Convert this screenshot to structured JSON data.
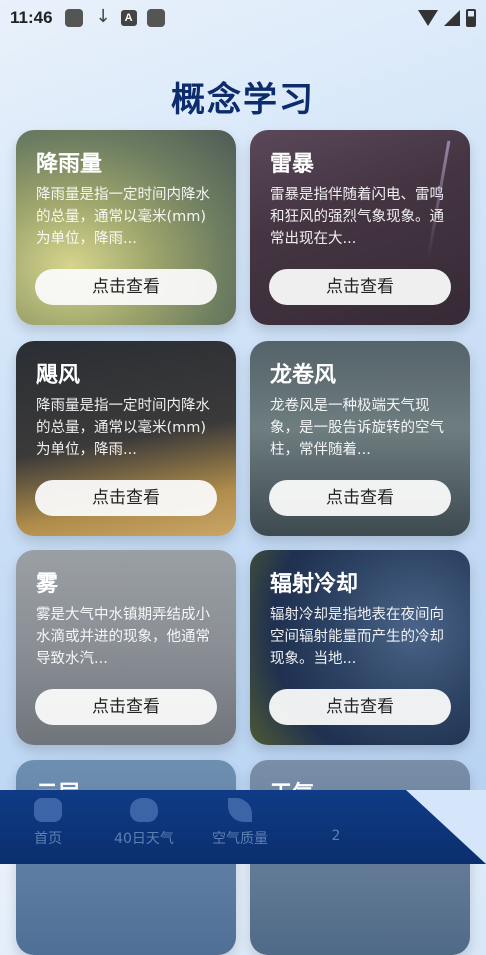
{
  "status": {
    "time": "11:46",
    "a_badge": "A"
  },
  "title": "概念学习",
  "cards": [
    {
      "title": "降雨量",
      "desc": "降雨量是指一定时间内降水的总量，通常以毫米(mm)为单位，降雨...",
      "button": "点击查看"
    },
    {
      "title": "雷暴",
      "desc": "雷暴是指伴随着闪电、雷鸣和狂风的强烈气象现象。通常出现在大...",
      "button": "点击查看"
    },
    {
      "title": "飓风",
      "desc": "降雨量是指一定时间内降水的总量，通常以毫米(mm)为单位，降雨...",
      "button": "点击查看"
    },
    {
      "title": "龙卷风",
      "desc": "龙卷风是一种极端天气现象，是一股告诉旋转的空气柱，常伴随着...",
      "button": "点击查看"
    },
    {
      "title": "雾",
      "desc": "雾是大气中水镇期弄结成小水滴或并进的现象，他通常导致水汽...",
      "button": "点击查看"
    },
    {
      "title": "辐射冷却",
      "desc": "辐射冷却是指地表在夜间向空间辐射能量而产生的冷却现象。当地...",
      "button": "点击查看"
    },
    {
      "title": "云层"
    },
    {
      "title": "天气"
    }
  ],
  "nav": [
    {
      "label": "首页",
      "icon": "home-icon"
    },
    {
      "label": "40日天气",
      "icon": "cloud-icon"
    },
    {
      "label": "空气质量",
      "icon": "leaf-icon"
    },
    {
      "label": "2",
      "icon": ""
    }
  ]
}
